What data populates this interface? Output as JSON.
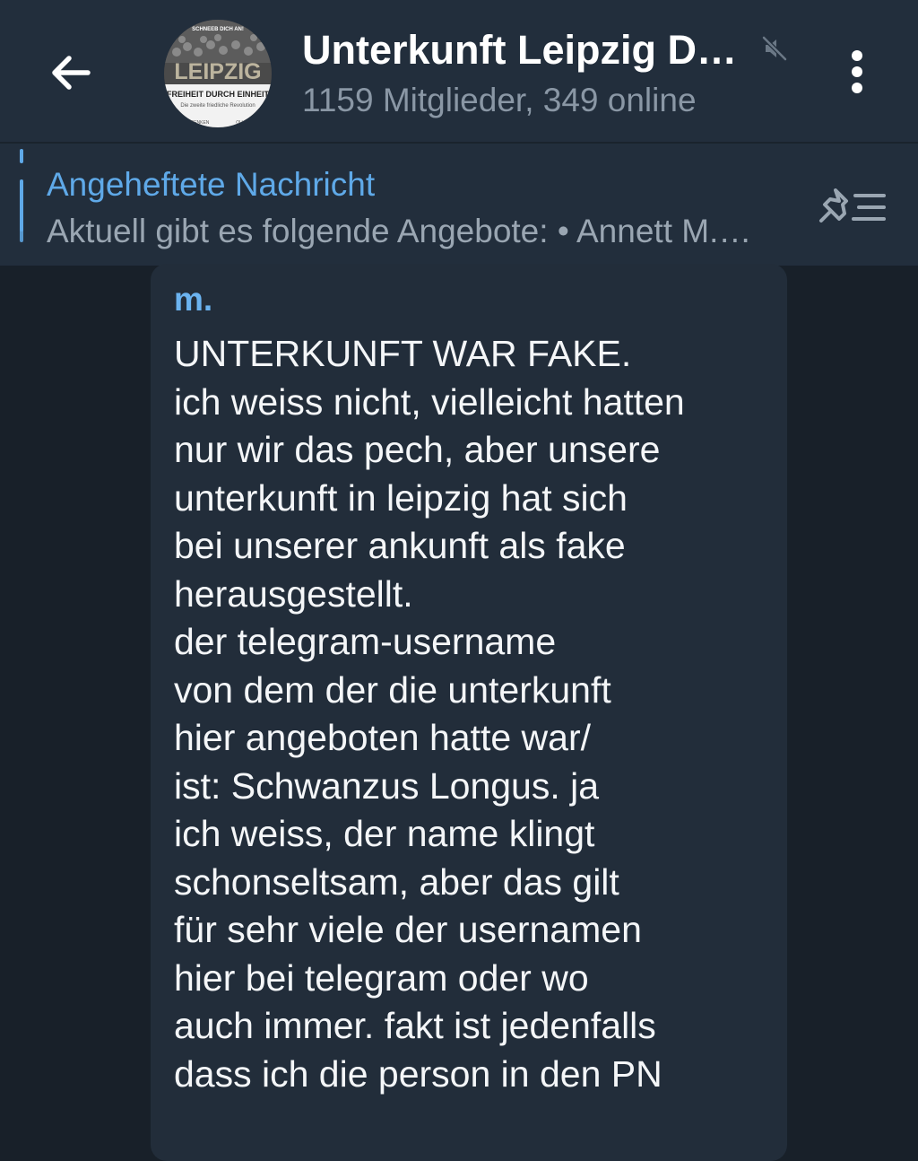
{
  "header": {
    "back_icon": "arrow-left-icon",
    "title": "Unterkunft Leipzig D…",
    "muted_icon": "muted-speaker-icon",
    "subtitle": "1159 Mitglieder, 349 online",
    "menu_icon": "more-vert-icon",
    "avatar": {
      "top_text": "SCHNEEB DICH AN!",
      "city": "LEIPZIG",
      "slogan": "FREIHEIT DURCH EINHEIT",
      "tagline": "Die zweite friedliche Revolution",
      "footer_left": "DENKEN",
      "footer_right": "OU"
    }
  },
  "pinned": {
    "title": "Angeheftete Nachricht",
    "preview": "Aktuell gibt es folgende Angebote: • Annett M.…",
    "list_icon": "pin-list-icon"
  },
  "message": {
    "sender": "m.",
    "lines": [
      "UNTERKUNFT WAR FAKE.",
      "ich weiss nicht, vielleicht hatten",
      "nur wir das pech, aber unsere",
      "unterkunft in leipzig hat sich",
      "bei unserer ankunft als fake",
      "herausgestellt.",
      "der telegram-username",
      "von dem der die unterkunft",
      "hier angeboten hatte war/",
      "ist: Schwanzus Longus. ja",
      "ich weiss, der name klingt",
      "schonseltsam, aber das gilt",
      "für sehr viele der usernamen",
      "hier bei telegram oder wo",
      "auch immer. fakt ist jedenfalls",
      "dass ich die person in den PN"
    ]
  },
  "colors": {
    "header_bg": "#222e3c",
    "chat_bg": "#182029",
    "bubble_bg": "#222d3a",
    "accent": "#5fa9e8",
    "secondary_text": "#8a97a5"
  }
}
